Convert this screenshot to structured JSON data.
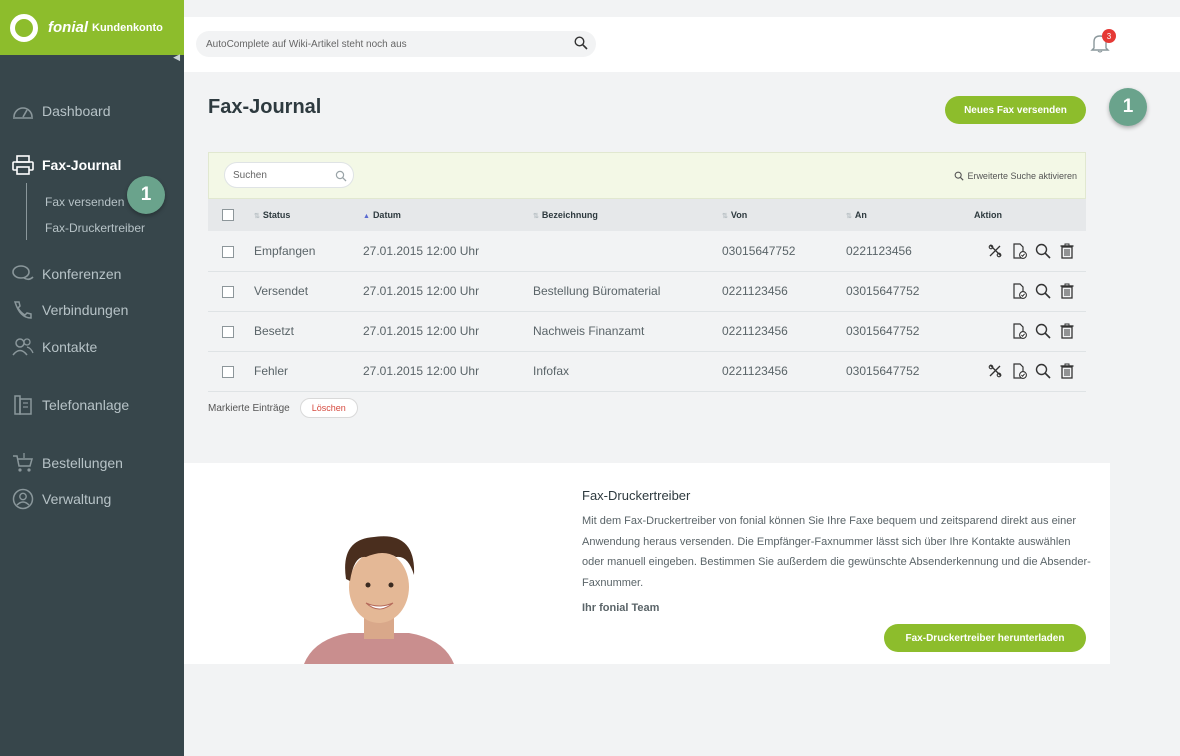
{
  "brand": {
    "name": "fonial",
    "product": "Kundenkonto",
    "color": "#8dbd2c"
  },
  "search": {
    "placeholder": "AutoComplete auf Wiki-Artikel steht noch aus"
  },
  "notifications": {
    "count": "3"
  },
  "sidebar": {
    "items": [
      {
        "label": "Dashboard",
        "icon": "dashboard-icon"
      },
      {
        "label": "Fax-Journal",
        "icon": "printer-icon",
        "active": true
      },
      {
        "label": "Konferenzen",
        "icon": "chat-icon"
      },
      {
        "label": "Verbindungen",
        "icon": "phone-icon"
      },
      {
        "label": "Kontakte",
        "icon": "contacts-icon"
      },
      {
        "label": "Telefonanlage",
        "icon": "pbx-icon"
      },
      {
        "label": "Bestellungen",
        "icon": "cart-icon"
      },
      {
        "label": "Verwaltung",
        "icon": "user-circle-icon"
      }
    ],
    "subitems": [
      "Fax versenden",
      "Fax-Druckertreiber"
    ]
  },
  "step_badges": [
    "1",
    "1"
  ],
  "page": {
    "title": "Fax-Journal",
    "new_fax_label": "Neues Fax versenden"
  },
  "journal": {
    "search_placeholder": "Suchen",
    "advanced_search": "Erweiterte Suche aktivieren",
    "columns": {
      "status": "Status",
      "datum": "Datum",
      "bezeichnung": "Bezeichnung",
      "von": "Von",
      "an": "An",
      "aktion": "Aktion"
    },
    "rows": [
      {
        "status": "Empfangen",
        "datum": "27.01.2015 12:00 Uhr",
        "bezeichnung": "",
        "von": "03015647752",
        "an": "0221123456",
        "resend": true
      },
      {
        "status": "Versendet",
        "datum": "27.01.2015 12:00 Uhr",
        "bezeichnung": "Bestellung Büromaterial",
        "von": "0221123456",
        "an": "03015647752",
        "resend": false
      },
      {
        "status": "Besetzt",
        "datum": "27.01.2015 12:00 Uhr",
        "bezeichnung": "Nachweis Finanzamt",
        "von": "0221123456",
        "an": "03015647752",
        "resend": false
      },
      {
        "status": "Fehler",
        "datum": "27.01.2015 12:00 Uhr",
        "bezeichnung": "Infofax",
        "von": "0221123456",
        "an": "03015647752",
        "resend": true
      }
    ],
    "bulk_label": "Markierte Einträge",
    "delete_label": "Löschen"
  },
  "promo": {
    "title": "Fax-Druckertreiber",
    "text": "Mit dem Fax-Druckertreiber von fonial können Sie Ihre Faxe bequem und zeitsparend direkt aus einer Anwendung heraus versenden. Die Empfänger-Faxnummer lässt sich über Ihre Kontakte auswählen oder manuell eingeben. Bestimmen Sie außerdem die gewünschte Absenderkennung und die Absender-Faxnummer.",
    "signature": "Ihr fonial Team",
    "download_label": "Fax-Druckertreiber herunterladen"
  }
}
